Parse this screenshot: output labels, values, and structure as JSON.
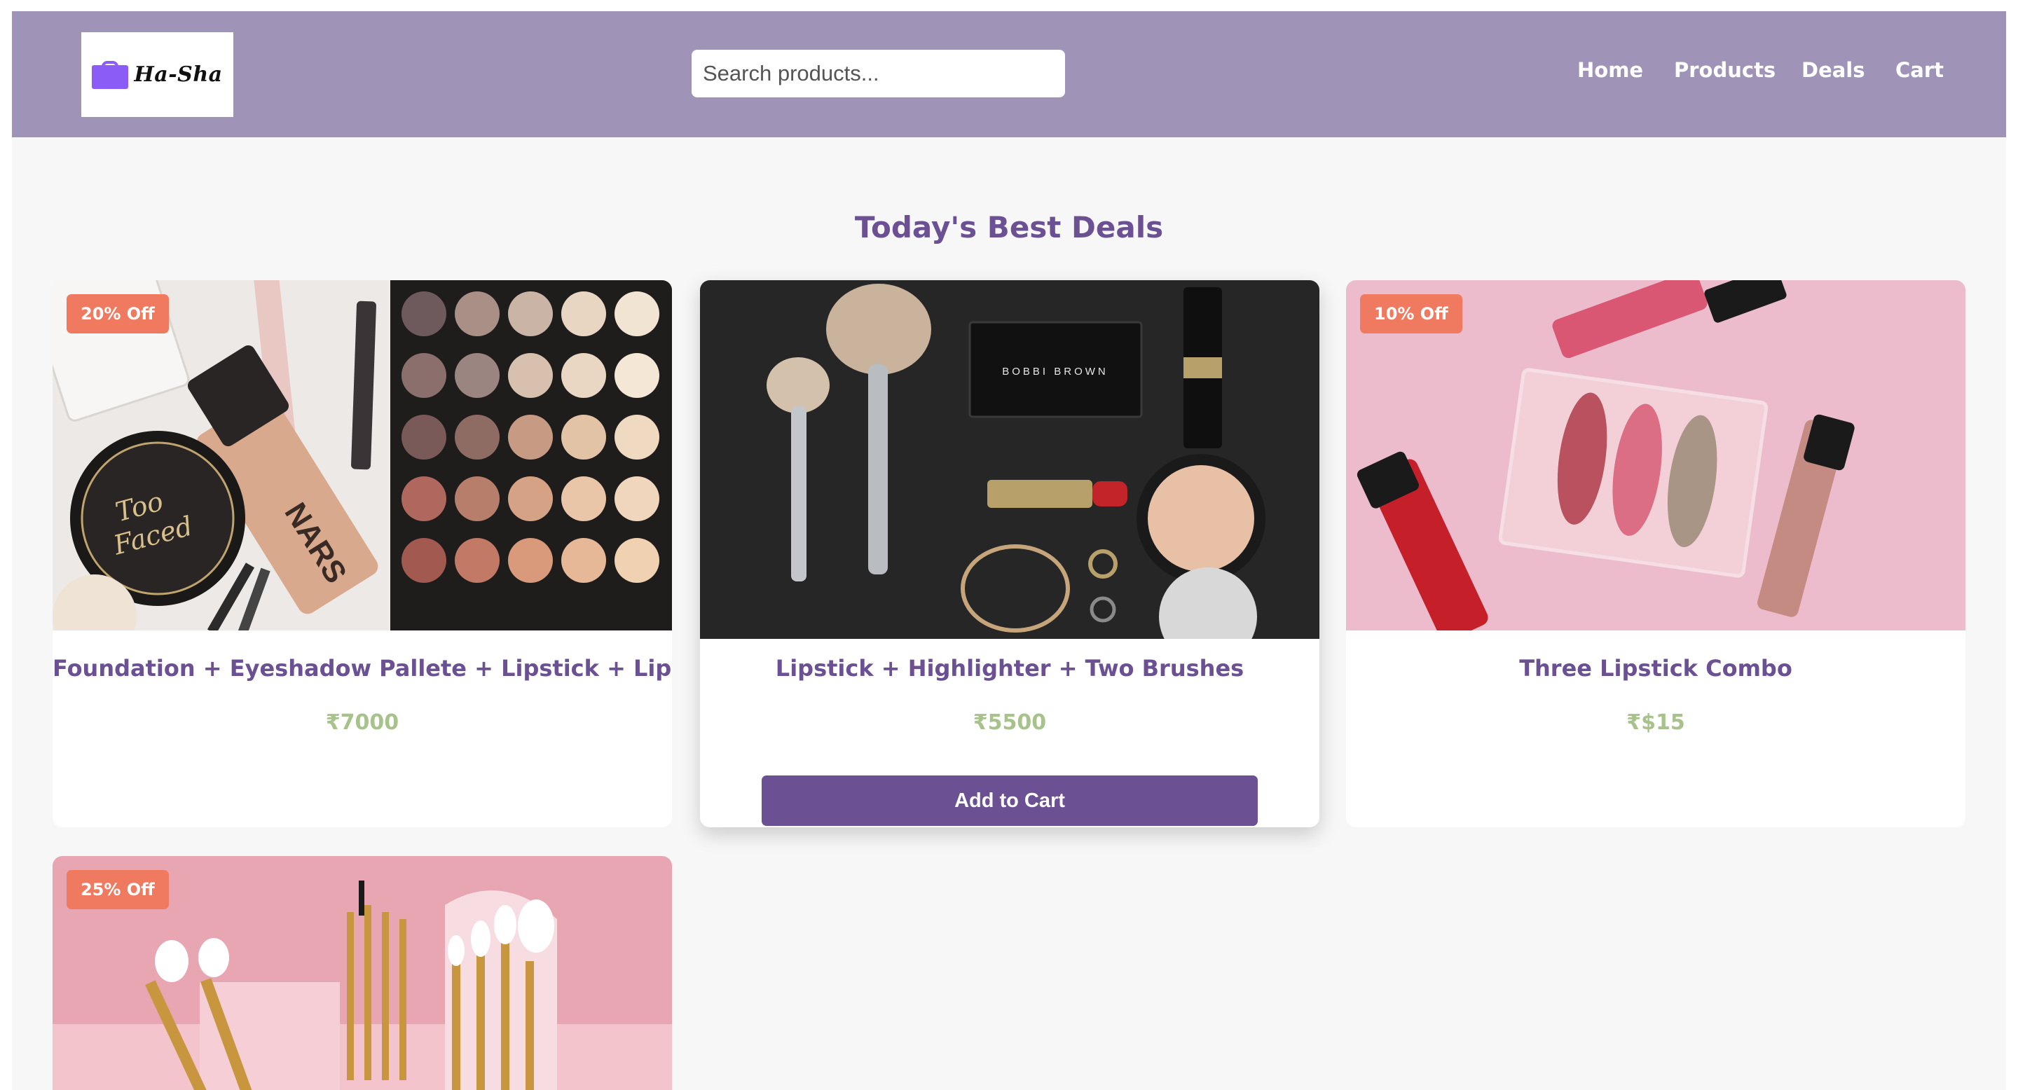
{
  "header": {
    "logo_text": "Ha-Sha",
    "search": {
      "placeholder": "Search products...",
      "value": ""
    },
    "nav": {
      "home": "Home",
      "products": "Products",
      "deals": "Deals",
      "cart": "Cart"
    },
    "colors": {
      "background": "#9f93b8",
      "brand_icon": "#8b5cf6"
    }
  },
  "main": {
    "title": "Today's Best Deals",
    "colors": {
      "accent": "#6b5093",
      "price": "#a7c28a",
      "badge": "#ef7a5f"
    },
    "products": [
      {
        "badge": "20% Off",
        "name": "Foundation + Eyeshadow Pallete + Lipstick + Lip Gloss",
        "price": "₹7000",
        "image": "makeup-flatlay-eyeshadow-palette"
      },
      {
        "badge": "",
        "name": "Lipstick + Highlighter + Two Brushes",
        "price": "₹5500",
        "image": "makeup-flatlay-dark-background",
        "button": "Add to Cart",
        "image_text": "BOBBI BROWN"
      },
      {
        "badge": "10% Off",
        "name": "Three Lipstick Combo",
        "price": "₹$15",
        "image": "lip-gloss-pink-background"
      },
      {
        "badge": "25% Off",
        "image": "brush-set-pink-background"
      }
    ]
  }
}
